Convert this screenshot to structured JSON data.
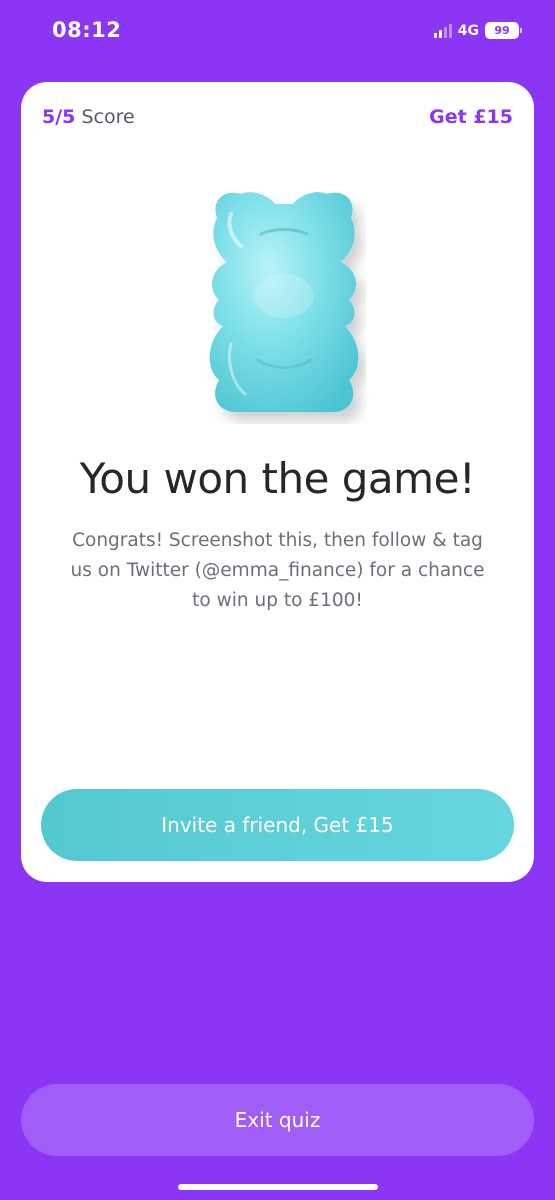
{
  "status_bar": {
    "time": "08:12",
    "network": "4G",
    "battery": "99"
  },
  "card": {
    "score_value": "5/5",
    "score_label": "Score",
    "reward_label": "Get £15",
    "mascot_icon": "gummy-bear-icon",
    "headline": "You won the game!",
    "message": "Congrats! Screenshot this, then follow & tag us on Twitter (@emma_finance) for a chance to win up to  £100!",
    "invite_button_label": "Invite a friend, Get £15"
  },
  "footer": {
    "exit_label": "Exit quiz"
  },
  "colors": {
    "background": "#8b35f5",
    "accent": "#8b35f5",
    "invite_button": "#5ccfd7",
    "exit_button": "#a05ef6"
  }
}
